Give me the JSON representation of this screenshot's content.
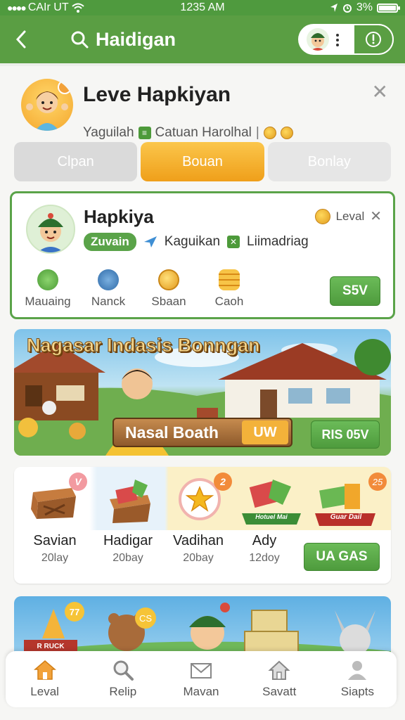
{
  "status": {
    "carrier": "CAIr UT",
    "time": "1235 AM",
    "battery": "3%"
  },
  "appbar": {
    "title": "Haidigan"
  },
  "header": {
    "title": "Leve Hapkiyan",
    "subtitle_a": "Yaguilah",
    "subtitle_b": "Catuan Harolhal"
  },
  "tabs": [
    {
      "label": "Clpan"
    },
    {
      "label": "Bouan"
    },
    {
      "label": "Bonlay"
    }
  ],
  "profile": {
    "name": "Hapkiya",
    "level_label": "Leval",
    "chip": "Zuvain",
    "tag1": "Kaguikan",
    "tag2": "Liimadriag",
    "stats": [
      {
        "label": "Mauaing"
      },
      {
        "label": "Nanck"
      },
      {
        "label": "Sbaan"
      },
      {
        "label": "Caoh"
      }
    ],
    "button": "S5V"
  },
  "banner": {
    "title": "Nagasar Indasis Bonngan",
    "plank_text": "Nasal Boath",
    "plank_tag": "UW",
    "button": "RIS 05V"
  },
  "rewards": {
    "items": [
      {
        "name": "Savian",
        "days": "20lay",
        "badge": "V"
      },
      {
        "name": "Hadigar",
        "days": "20bay"
      },
      {
        "name": "Vadihan",
        "days": "20bay",
        "badge": "2"
      },
      {
        "name": "Ady",
        "days": "12doy"
      }
    ],
    "ribbon1": "Hotuel Mai",
    "ribbon2": "Guar Dail",
    "coin_badge": "25",
    "button": "UA GAS"
  },
  "strip2": {
    "badge1": "77",
    "badge2": "CS",
    "sign": "R RUCK"
  },
  "nav": [
    {
      "label": "Leval"
    },
    {
      "label": "Relip"
    },
    {
      "label": "Mavan"
    },
    {
      "label": "Savatt"
    },
    {
      "label": "Siapts"
    }
  ]
}
